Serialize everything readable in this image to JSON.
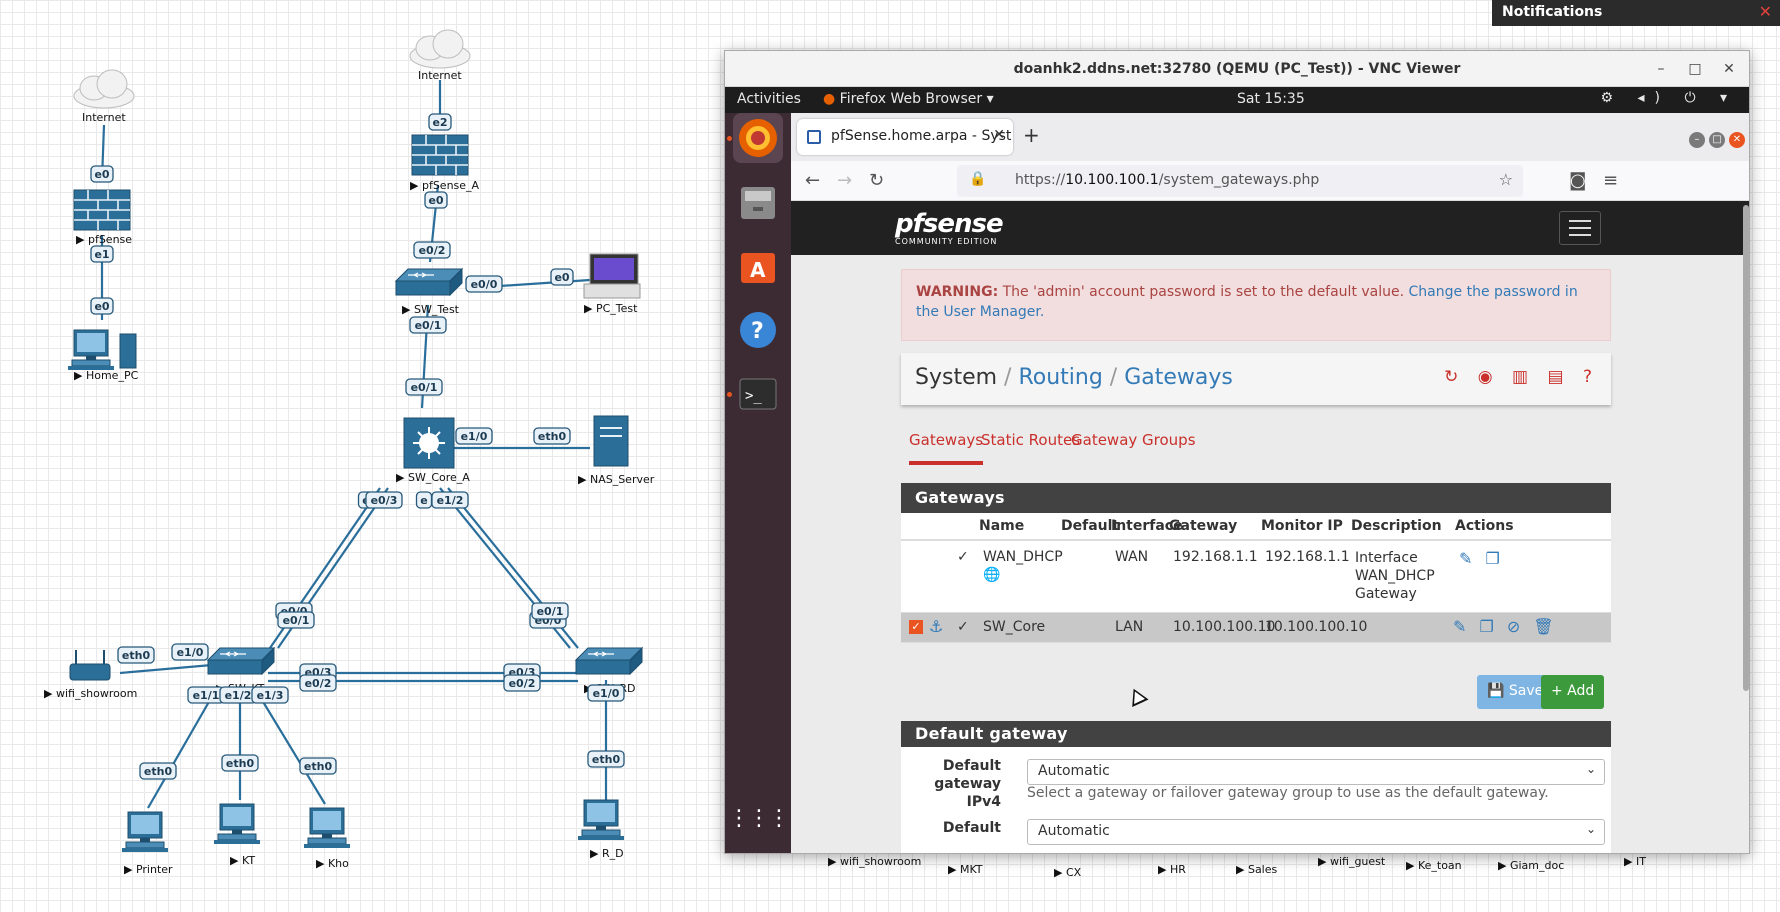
{
  "topology": {
    "nodes": {
      "internet_left": "Internet",
      "internet_top": "Internet",
      "pfsense": "pfSense",
      "pfsense_a": "pfSense_A",
      "home_pc": "Home_PC",
      "sw_test": "SW_Test",
      "pc_test": "PC_Test",
      "sw_core_a": "SW_Core_A",
      "nas_server": "NAS_Server",
      "wifi_showroom": "wifi_showroom",
      "sw_kt": "SW_KT",
      "sw_rd": "SW_RD",
      "printer": "Printer",
      "kt": "KT",
      "kho": "Kho",
      "r_d": "R_D"
    },
    "ports": {
      "pfs_e0": "e0",
      "pfs_e1": "e1",
      "home_e0": "e0",
      "pfa_e2": "e2",
      "pfa_e0": "e0",
      "swt_e02": "e0/2",
      "swt_e00": "e0/0",
      "pct_e0": "e0",
      "swt_e01": "e0/1",
      "core_e01": "e0/1",
      "core_e10": "e1/0",
      "nas_eth0": "eth0",
      "core_e03": "e0/3",
      "core_e03b": "e",
      "core_e12": "e1/2",
      "core_e12b": "e",
      "kt_e01": "e0/1",
      "kt_e01b": "e0/0",
      "rd_e01": "e0/1",
      "rd_e01b": "e0/0",
      "wifi_eth0": "eth0",
      "kt_e10": "e1/0",
      "kt_e03": "e0/3",
      "kt_e02": "e0/2",
      "rd_e03": "e0/3",
      "rd_e02": "e0/2",
      "kt_e11": "e1/1",
      "kt_e12": "e1/2",
      "kt_e13": "e1/3",
      "printer_eth0": "eth0",
      "ktpc_eth0": "eth0",
      "kho_eth0": "eth0",
      "rd_e10": "e1/0",
      "rdpc_eth0": "eth0"
    },
    "bottom_nodes": [
      "wifi_showroom",
      "MKT",
      "CX",
      "HR",
      "Sales",
      "wifi_guest",
      "Ke_toan",
      "Giam_doc",
      "IT"
    ]
  },
  "notifications": {
    "title": "Notifications",
    "close": "✕"
  },
  "vnc": {
    "title": "doanhk2.ddns.net:32780 (QEMU (PC_Test)) - VNC Viewer",
    "minimize": "–",
    "maximize": "□",
    "close": "✕"
  },
  "gnome": {
    "activities": "Activities",
    "app_menu": "Firefox Web Browser ▾",
    "clock": "Sat 15:35",
    "tray": "⚙ ◂) ⏻ ▾"
  },
  "dock": {
    "apps_grid": "⋮⋮⋮"
  },
  "firefox": {
    "tab_title": "pfSense.home.arpa - Syst",
    "tab_close": "✕",
    "new_tab": "+",
    "url_prefix": "https://",
    "url_host": "10.100.100.1",
    "url_path": "/system_gateways.php",
    "back": "←",
    "forward": "→",
    "reload": "↻",
    "pocket": "◙",
    "menu": "≡",
    "star": "☆",
    "lock": "🔒"
  },
  "pfsense": {
    "logo": "pfsense",
    "logo_sub": "COMMUNITY EDITION",
    "warning_bold": "WARNING:",
    "warning_text": " The 'admin' account password is set to the default value. ",
    "warning_link": "Change the password in the User Manager.",
    "breadcrumb": {
      "system": "System",
      "routing": "Routing",
      "gateways": "Gateways",
      "sep": " / "
    },
    "bc_icons": "↻ ◉ ▥ ▤ ?",
    "tabs": [
      "Gateways",
      "Static Routes",
      "Gateway Groups"
    ],
    "gateways_panel": "Gateways",
    "columns": [
      "Name",
      "Default",
      "Interface",
      "Gateway",
      "Monitor IP",
      "Description",
      "Actions"
    ],
    "rows": [
      {
        "name": "WAN_DHCP",
        "interface": "WAN",
        "gateway": "192.168.1.1",
        "monitor": "192.168.1.1",
        "description": "Interface WAN_DHCP Gateway",
        "status": "✓",
        "globe": "🌐",
        "actions": "✎ ❐"
      },
      {
        "name": "SW_Core",
        "interface": "LAN",
        "gateway": "10.100.100.10",
        "monitor": "10.100.100.10",
        "description": "",
        "status": "✓",
        "anchor": "⚓",
        "check": "✓",
        "actions": "✎ ❐ ⊘ 🗑"
      }
    ],
    "save": "💾 Save",
    "add": "+ Add",
    "default_panel": "Default gateway",
    "dg_ipv4_label": "Default gateway IPv4",
    "dg_ipv4_value": "Automatic",
    "dg_help": "Select a gateway or failover gateway group to use as the default gateway.",
    "dg_ipv6_label": "Default",
    "dg_ipv6_value": "Automatic"
  }
}
